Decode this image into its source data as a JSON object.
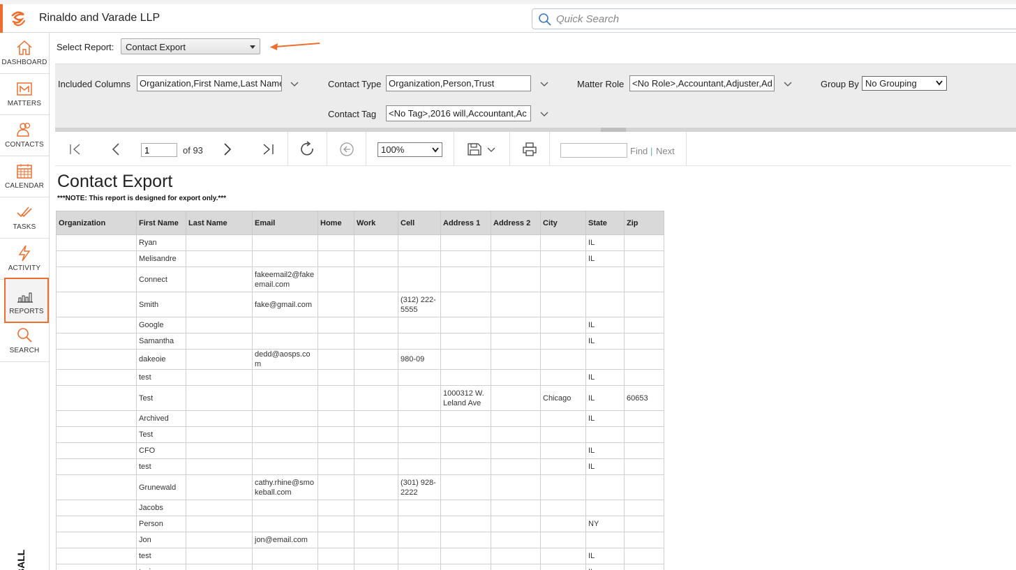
{
  "app": {
    "firm_name": "Rinaldo and Varade LLP",
    "brand_text": "BALL",
    "accent_color": "#ee6f2d"
  },
  "search": {
    "placeholder": "Quick Search"
  },
  "nav": {
    "items": [
      {
        "label": "DASHBOARD",
        "icon": "home-icon"
      },
      {
        "label": "MATTERS",
        "icon": "briefcase-icon"
      },
      {
        "label": "CONTACTS",
        "icon": "people-icon"
      },
      {
        "label": "CALENDAR",
        "icon": "calendar-icon"
      },
      {
        "label": "TASKS",
        "icon": "checkmarks-icon"
      },
      {
        "label": "ACTIVITY",
        "icon": "lightning-icon"
      },
      {
        "label": "REPORTS",
        "icon": "bar-chart-icon"
      },
      {
        "label": "SEARCH",
        "icon": "search-icon"
      }
    ],
    "active": "REPORTS"
  },
  "select_report": {
    "label": "Select Report:",
    "value": "Contact Export"
  },
  "params": {
    "included_columns": {
      "label": "Included Columns",
      "value": "Organization,First Name,Last Name"
    },
    "contact_type": {
      "label": "Contact Type",
      "value": "Organization,Person,Trust"
    },
    "matter_role": {
      "label": "Matter Role",
      "value": "<No Role>,Accountant,Adjuster,Ad"
    },
    "group_by": {
      "label": "Group By",
      "value": "No Grouping"
    },
    "contact_tag": {
      "label": "Contact Tag",
      "value": "<No Tag>,2016 will,Accountant,Ac"
    }
  },
  "toolbar": {
    "page": "1",
    "of_pages": "of 93",
    "zoom": "100%",
    "find_label": "Find",
    "separator": "|",
    "next_label": "Next"
  },
  "report": {
    "title": "Contact Export",
    "note": "***NOTE: This report is designed for export only.***",
    "columns": [
      "Organization",
      "First Name",
      "Last Name",
      "Email",
      "Home",
      "Work",
      "Cell",
      "Address 1",
      "Address 2",
      "City",
      "State",
      "Zip"
    ],
    "rows": [
      [
        "",
        "Ryan",
        "",
        "",
        "",
        "",
        "",
        "",
        "",
        "",
        "IL",
        ""
      ],
      [
        "",
        "Melisandre",
        "",
        "",
        "",
        "",
        "",
        "",
        "",
        "",
        "IL",
        ""
      ],
      [
        "",
        "Connect",
        "",
        "fakeemail2@fakeemail.com",
        "",
        "",
        "",
        "",
        "",
        "",
        "",
        ""
      ],
      [
        "",
        "Smith",
        "",
        "fake@gmail.com",
        "",
        "",
        "(312) 222-5555",
        "",
        "",
        "",
        "",
        ""
      ],
      [
        "",
        "Google",
        "",
        "",
        "",
        "",
        "",
        "",
        "",
        "",
        "IL",
        ""
      ],
      [
        "",
        "Samantha",
        "",
        "",
        "",
        "",
        "",
        "",
        "",
        "",
        "IL",
        ""
      ],
      [
        "",
        "dakeoie",
        "",
        "dedd@aosps.com",
        "",
        "",
        "980-09",
        "",
        "",
        "",
        "",
        ""
      ],
      [
        "",
        "test",
        "",
        "",
        "",
        "",
        "",
        "",
        "",
        "",
        "IL",
        ""
      ],
      [
        "",
        "Test",
        "",
        "",
        "",
        "",
        "",
        "1000312 W. Leland Ave",
        "",
        "Chicago",
        "IL",
        "60653"
      ],
      [
        "",
        "Archived",
        "",
        "",
        "",
        "",
        "",
        "",
        "",
        "",
        "IL",
        ""
      ],
      [
        "",
        "Test",
        "",
        "",
        "",
        "",
        "",
        "",
        "",
        "",
        "",
        ""
      ],
      [
        "",
        "CFO",
        "",
        "",
        "",
        "",
        "",
        "",
        "",
        "",
        "IL",
        ""
      ],
      [
        "",
        "test",
        "",
        "",
        "",
        "",
        "",
        "",
        "",
        "",
        "IL",
        ""
      ],
      [
        "",
        "Grunewald",
        "",
        "cathy.rhine@smokeball.com",
        "",
        "",
        "(301) 928-2222",
        "",
        "",
        "",
        "",
        ""
      ],
      [
        "",
        "Jacobs",
        "",
        "",
        "",
        "",
        "",
        "",
        "",
        "",
        "",
        ""
      ],
      [
        "",
        "Person",
        "",
        "",
        "",
        "",
        "",
        "",
        "",
        "",
        "NY",
        ""
      ],
      [
        "",
        "Jon",
        "",
        "jon@email.com",
        "",
        "",
        "",
        "",
        "",
        "",
        "",
        ""
      ],
      [
        "",
        "test",
        "",
        "",
        "",
        "",
        "",
        "",
        "",
        "",
        "IL",
        ""
      ],
      [
        "",
        "tesing",
        "",
        "",
        "",
        "",
        "",
        "",
        "",
        "",
        "IL",
        ""
      ]
    ]
  }
}
